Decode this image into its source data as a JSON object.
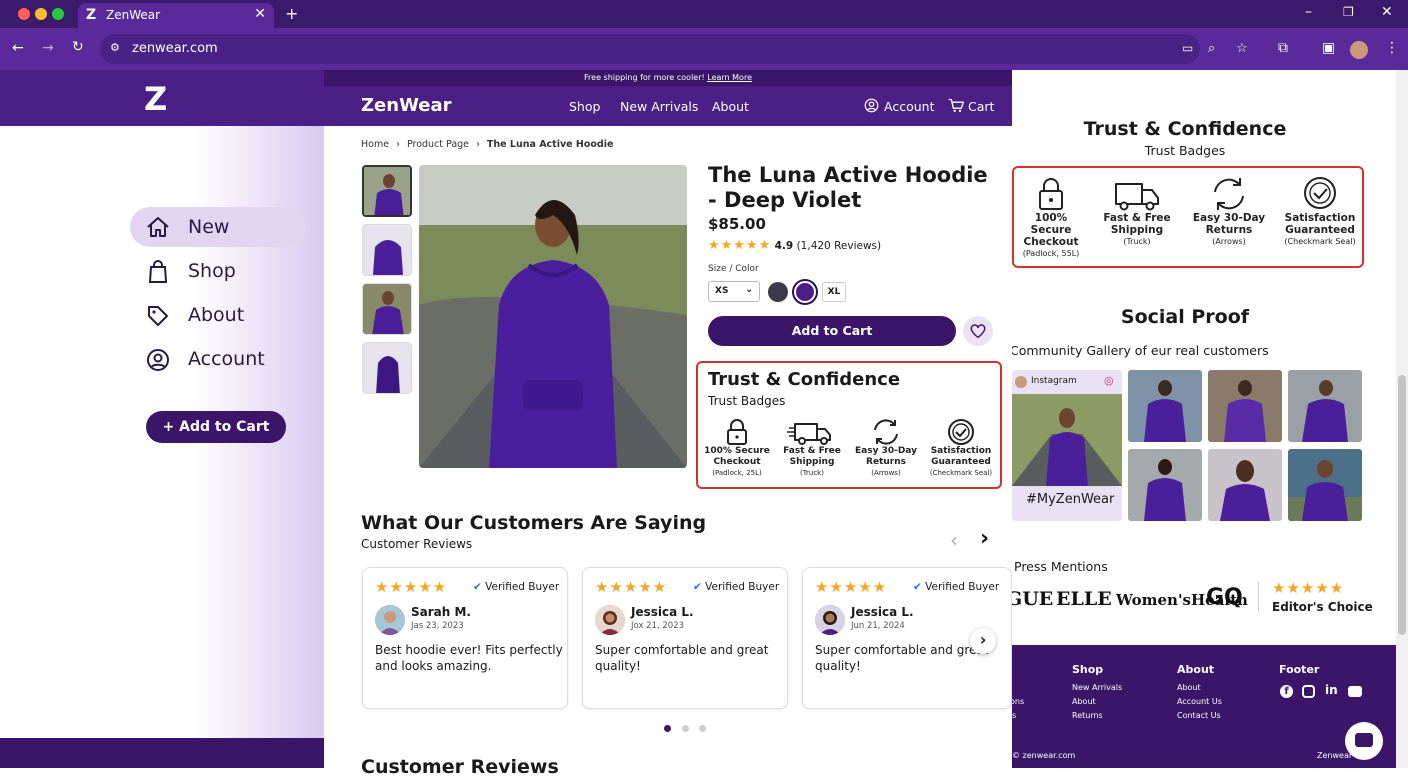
{
  "browser": {
    "tab_title": "ZenWear",
    "tab_icon": "Z",
    "url": "zenwear.com"
  },
  "left_panel": {
    "logo": "Z",
    "nav": [
      {
        "label": "New",
        "icon": "home-icon"
      },
      {
        "label": "Shop",
        "icon": "shopping-bag-icon"
      },
      {
        "label": "About",
        "icon": "tag-icon"
      },
      {
        "label": "Account",
        "icon": "user-circle-icon"
      }
    ],
    "add_to_cart": "+ Add to Cart"
  },
  "promo": {
    "text": "Free shipping for more cooler!",
    "link": "Learn More"
  },
  "header": {
    "brand": "ZenWear",
    "links": [
      "Shop",
      "New Arrivals",
      "About"
    ],
    "account": "Account",
    "cart": "Cart"
  },
  "breadcrumb": [
    "Home",
    "Product Page",
    "The Luna Active Hoodie"
  ],
  "product": {
    "title": "The Luna Active Hoodie - Deep Violet",
    "price": "$85.00",
    "rating": "4.9",
    "review_count": "(1,420 Reviews)",
    "stars": "★★★★★",
    "size_color_label": "Size / Color",
    "size": "XS",
    "size_alt": "XL",
    "colors": [
      "#3a3a4a",
      "#4b1f86"
    ],
    "add_to_cart": "Add to Cart"
  },
  "trust": {
    "title": "Trust & Confidence",
    "subtitle": "Trust Badges",
    "badges": [
      {
        "l1": "100% Secure",
        "l2": "Checkout",
        "sub": "(Padlock, 25L)",
        "icon": "padlock-icon"
      },
      {
        "l1": "Fast & Free",
        "l2": "Shipping",
        "sub": "(Truck)",
        "icon": "truck-icon"
      },
      {
        "l1": "Easy 30-Day",
        "l2": "Returns",
        "sub": "(Arrows)",
        "icon": "arrows-icon"
      },
      {
        "l1": "Satisfaction",
        "l2": "Guaranteed",
        "sub": "(Checkmark Seal)",
        "icon": "checkmark-seal-icon"
      }
    ]
  },
  "trust_right": {
    "title": "Trust & Confidence",
    "subtitle": "Trust Badges",
    "badges": [
      {
        "l1": "100% Secure",
        "l2": "Checkout",
        "sub": "(Padlock, 55L)"
      },
      {
        "l1": "Fast & Free",
        "l2": "Shipping",
        "sub": "(Truck)"
      },
      {
        "l1": "Easy 30-Day",
        "l2": "Returns",
        "sub": "(Arrows)"
      },
      {
        "l1": "Satisfaction",
        "l2": "Guaranteed",
        "sub": "(Checkmark Seal)"
      }
    ]
  },
  "reviews": {
    "title": "What Our Customers Are Saying",
    "subtitle": "Customer Reviews",
    "next_title": "Customer Reviews",
    "verified": "Verified Buyer",
    "items": [
      {
        "name": "Sarah M.",
        "date": "Jas 23, 2023",
        "text1": "Best hoodie ever! Fits perfectly",
        "text2": "and looks amazing."
      },
      {
        "name": "Jessica L.",
        "date": "Jox 21, 2023",
        "text1": "Super comfortable and great",
        "text2": "quality!"
      },
      {
        "name": "Jessica L.",
        "date": "Jun 21, 2024",
        "text1": "Super comfortable and great",
        "text2": "quality!"
      }
    ]
  },
  "social": {
    "title": "Social Proof",
    "gallery_caption": "Community Gallery of eur real customers",
    "instagram": "Instagram",
    "hashtag": "#MyZenWear"
  },
  "press": {
    "title": "Press Mentions",
    "logos": [
      "GUE",
      "ELLE",
      "Women'sHealth",
      "GQ"
    ],
    "editors": "Editor's Choice",
    "editor_stars": "★★★★★"
  },
  "footer": {
    "col0": [
      "ons",
      "s"
    ],
    "shop_title": "Shop",
    "shop": [
      "New Arrivals",
      "About",
      "Returns"
    ],
    "about_title": "About",
    "about": [
      "About",
      "Account Us",
      "Contact Us"
    ],
    "footer_title": "Footer",
    "copyright": "© zenwear.com",
    "lang": "Zenwear ▾"
  },
  "colors": {
    "brand": "#4b1f86",
    "dark": "#3b1668",
    "star": "#f5a623",
    "alert": "#d63030"
  }
}
